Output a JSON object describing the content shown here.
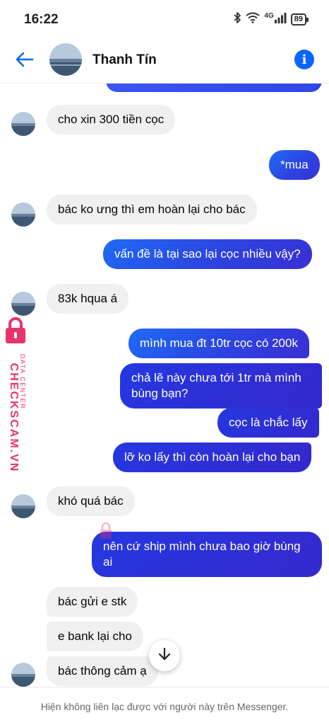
{
  "status_bar": {
    "time": "16:22",
    "network": "4G",
    "battery": "89"
  },
  "header": {
    "contact_name": "Thanh Tín",
    "accent_color": "#0866ff"
  },
  "messages": [
    {
      "direction": "incoming",
      "text": "cho xin 300 tiền cọc"
    },
    {
      "direction": "outgoing",
      "text": "*mua"
    },
    {
      "direction": "incoming",
      "text": "bác ko ưng thì em hoàn lại cho bác"
    },
    {
      "direction": "outgoing",
      "text": "vấn đề là tại sao lại cọc nhiều vậy?"
    },
    {
      "direction": "incoming",
      "text": "83k hqua á"
    },
    {
      "direction": "outgoing",
      "text": "mình mua đt 10tr cọc có 200k"
    },
    {
      "direction": "outgoing",
      "text": "chả lẽ này chưa tới 1tr mà mình bùng bạn?"
    },
    {
      "direction": "outgoing",
      "text": "cọc là chắc lấy"
    },
    {
      "direction": "outgoing",
      "text": "lỡ ko lấy thì còn hoàn lại cho bạn"
    },
    {
      "direction": "incoming",
      "text": "khó quá bác"
    },
    {
      "direction": "outgoing",
      "text": "nên cứ ship mình chưa bao giờ bùng ai"
    },
    {
      "direction": "incoming",
      "text": "bác gửi e stk"
    },
    {
      "direction": "incoming",
      "text": "e bank lại cho"
    },
    {
      "direction": "incoming",
      "text": "bác thông cảm ạ"
    }
  ],
  "watermark": {
    "brand": "CHECKSCAM.VN",
    "tagline": "DATA CENTER",
    "color": "#e8336d"
  },
  "footer": {
    "notice": "Hiện không liên lạc được với người này trên Messenger."
  }
}
